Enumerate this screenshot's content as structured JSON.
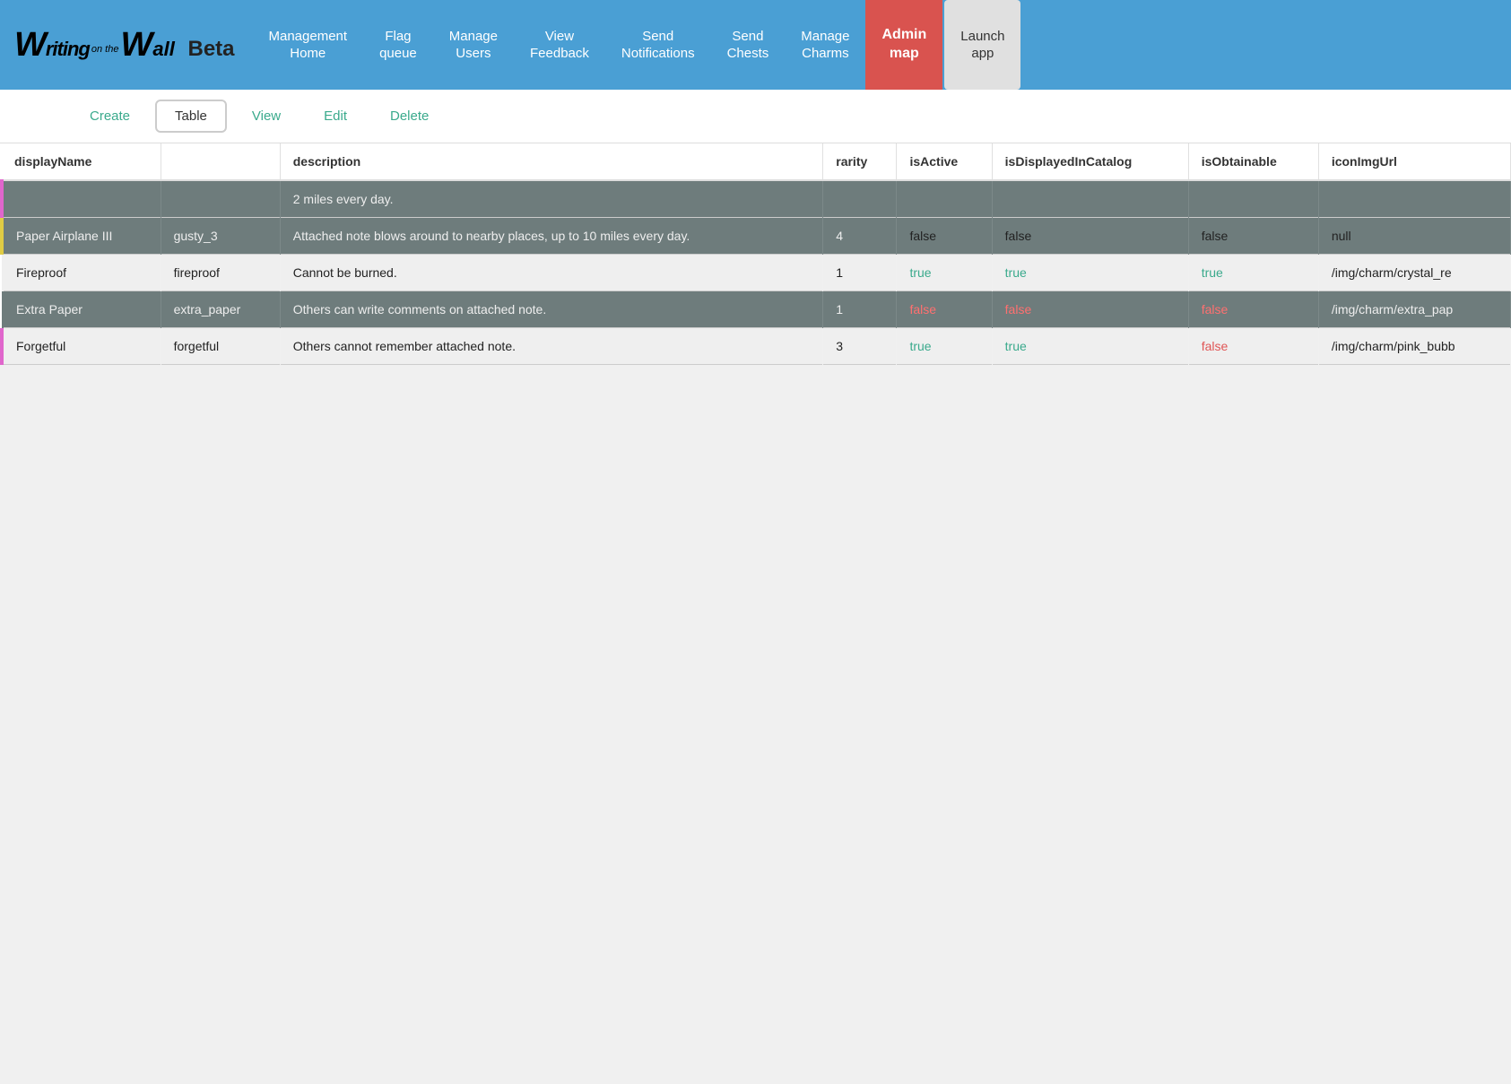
{
  "logo": {
    "writing": "W",
    "riting": "riting",
    "on_the": "on the",
    "wall_w": "W",
    "all": "all",
    "beta": "Beta"
  },
  "nav": {
    "items": [
      {
        "id": "management-home",
        "label": "Management\nHome"
      },
      {
        "id": "flag-queue",
        "label": "Flag\nqueue"
      },
      {
        "id": "manage-users",
        "label": "Manage\nUsers"
      },
      {
        "id": "view-feedback",
        "label": "View\nFeedback"
      },
      {
        "id": "send-notifications",
        "label": "Send\nNotifications"
      },
      {
        "id": "send-chests",
        "label": "Send\nChests"
      },
      {
        "id": "manage-charms",
        "label": "Manage\nCharms"
      },
      {
        "id": "admin-map",
        "label": "Admin\nmap",
        "style": "admin-map"
      },
      {
        "id": "launch-app",
        "label": "Launch\napp",
        "style": "launch-app"
      }
    ]
  },
  "subnav": {
    "items": [
      {
        "id": "create",
        "label": "Create",
        "active": false
      },
      {
        "id": "table",
        "label": "Table",
        "active": true
      },
      {
        "id": "view",
        "label": "View",
        "active": false
      },
      {
        "id": "edit",
        "label": "Edit",
        "active": false
      },
      {
        "id": "delete",
        "label": "Delete",
        "active": false
      }
    ]
  },
  "table": {
    "columns": [
      "displayName",
      "",
      "description",
      "rarity",
      "isActive",
      "isDisplayedInCatalog",
      "isObtainable",
      "iconImgUrl"
    ],
    "rows": [
      {
        "displayName": "",
        "col2": "",
        "description": "2 miles every day.",
        "rarity": "",
        "isActive": "",
        "isDisplayedInCatalog": "",
        "isObtainable": "",
        "iconImgUrl": "",
        "borderColor": "pink"
      },
      {
        "displayName": "Paper Airplane III",
        "col2": "gusty_3",
        "description": "Attached note blows around to nearby places, up to 10 miles every day.",
        "rarity": "4",
        "isActive": "false",
        "isDisplayedInCatalog": "false",
        "isObtainable": "false",
        "iconImgUrl": "null",
        "borderColor": "yellow"
      },
      {
        "displayName": "Fireproof",
        "col2": "fireproof",
        "description": "Cannot be burned.",
        "rarity": "1",
        "isActive": "true",
        "isDisplayedInCatalog": "true",
        "isObtainable": "true",
        "iconImgUrl": "/img/charm/crystal_re",
        "borderColor": "none"
      },
      {
        "displayName": "Extra Paper",
        "col2": "extra_paper",
        "description": "Others can write comments on attached note.",
        "rarity": "1",
        "isActive": "false",
        "isDisplayedInCatalog": "false",
        "isObtainable": "false",
        "iconImgUrl": "/img/charm/extra_pap",
        "borderColor": "none"
      },
      {
        "displayName": "Forgetful",
        "col2": "forgetful",
        "description": "Others cannot remember attached note.",
        "rarity": "3",
        "isActive": "true",
        "isDisplayedInCatalog": "true",
        "isObtainable": "false",
        "iconImgUrl": "/img/charm/pink_bubb",
        "borderColor": "pink"
      }
    ]
  }
}
